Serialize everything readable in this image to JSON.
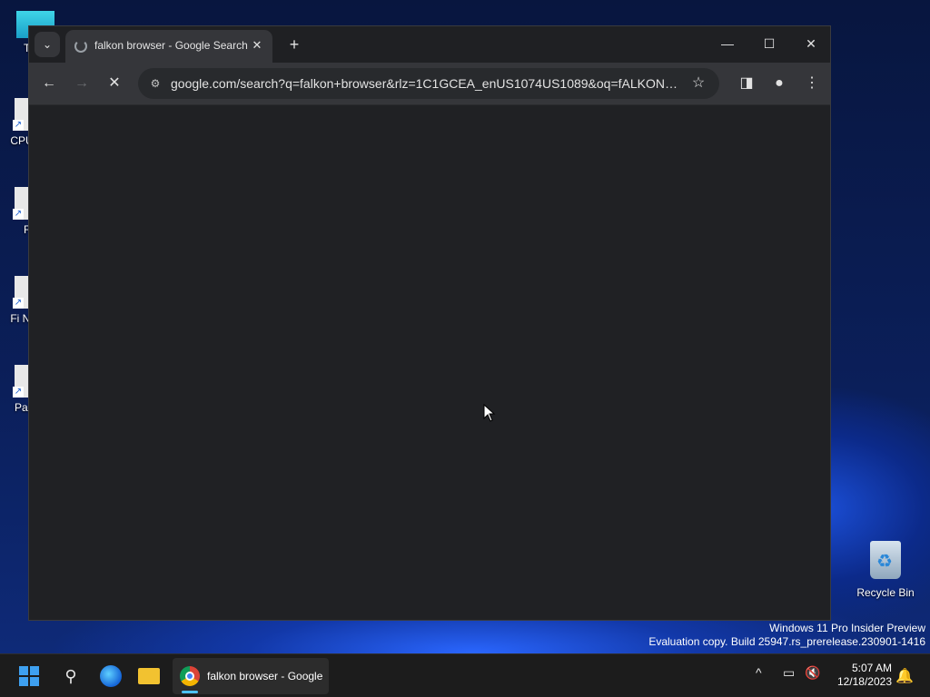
{
  "desktop": {
    "icons": [
      {
        "label": "Th"
      },
      {
        "label": "CPUI"
      },
      {
        "label": "Fu"
      },
      {
        "label": "Fi Ni"
      },
      {
        "label": "Pale"
      }
    ],
    "recycle_bin": {
      "label": "Recycle Bin"
    },
    "watermark": {
      "line1": "Windows 11 Pro Insider Preview",
      "line2": "Evaluation copy. Build 25947.rs_prerelease.230901-1416"
    }
  },
  "browser": {
    "tab": {
      "title": "falkon browser - Google Search",
      "close": "✕"
    },
    "new_tab": "+",
    "tab_search": "⌄",
    "window_controls": {
      "minimize": "—",
      "maximize": "☐",
      "close": "✕"
    },
    "toolbar": {
      "back": "←",
      "forward": "→",
      "stop": "✕"
    },
    "omnibox": {
      "url": "google.com/search?q=falkon+browser&rlz=1C1GCEA_enUS1074US1089&oq=fALKON+B...",
      "site_info_icon": "⚙",
      "bookmark_icon": "☆"
    },
    "side_panel_icon": "◨",
    "profile_icon": "●",
    "menu_icon": "⋮"
  },
  "taskbar": {
    "search_icon": "⚲",
    "chrome_app_label": "falkon browser - Google",
    "tray": {
      "chevron": "^",
      "network": "▭",
      "volume": "🔇"
    },
    "clock": {
      "time": "5:07 AM",
      "date": "12/18/2023"
    },
    "notifications_icon": "🔔"
  }
}
